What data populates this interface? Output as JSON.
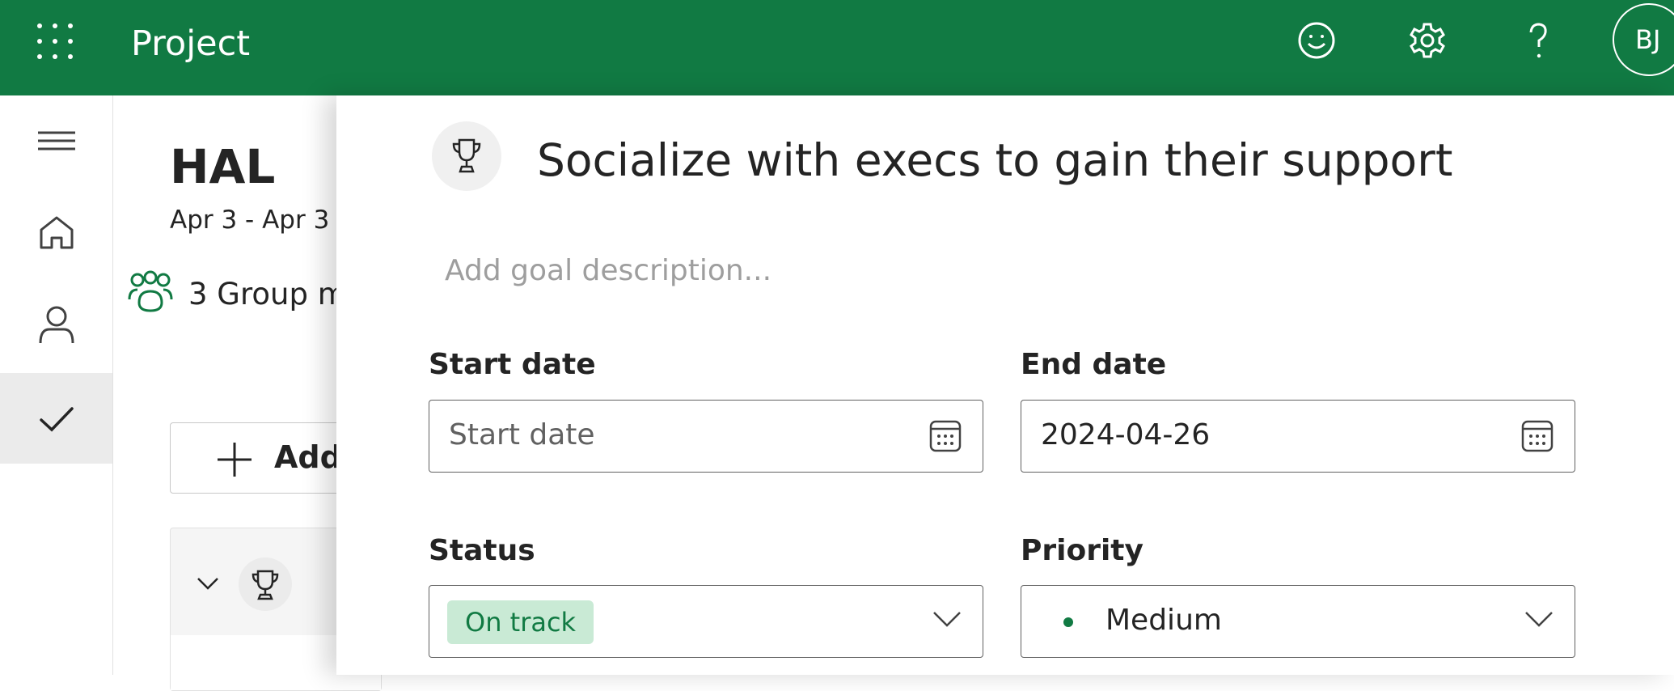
{
  "header": {
    "app_title": "Project",
    "user_initials": "BJ",
    "brand_color": "#117a43",
    "icons": [
      "waffle-icon",
      "feedback-smiley-icon",
      "settings-gear-icon",
      "help-question-icon"
    ]
  },
  "rail": {
    "items": [
      {
        "name": "menu",
        "icon": "hamburger-icon"
      },
      {
        "name": "home",
        "icon": "home-icon"
      },
      {
        "name": "people",
        "icon": "person-icon"
      },
      {
        "name": "tasks",
        "icon": "checkmark-icon",
        "active": true
      }
    ]
  },
  "background": {
    "plan_title": "HAL",
    "plan_dates": "Apr 3 - Apr 3",
    "members_text": "3 Group m",
    "add_label": "Add"
  },
  "panel": {
    "goal_title": "Socialize with execs to gain their support",
    "description_placeholder": "Add goal description...",
    "start_date": {
      "label": "Start date",
      "placeholder": "Start date",
      "value": ""
    },
    "end_date": {
      "label": "End date",
      "value": "2024-04-26"
    },
    "status": {
      "label": "Status",
      "value": "On track",
      "color": "#117a43"
    },
    "priority": {
      "label": "Priority",
      "value": "Medium",
      "dot_color": "#117a43"
    }
  }
}
